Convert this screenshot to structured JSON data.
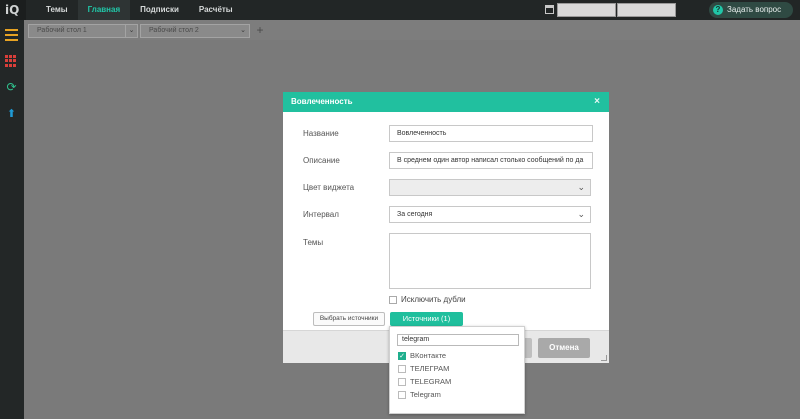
{
  "app": {
    "logo": "iQ"
  },
  "nav": {
    "tabs": [
      {
        "label": "Темы"
      },
      {
        "label": "Главная",
        "active": true
      },
      {
        "label": "Подписки"
      },
      {
        "label": "Расчёты"
      }
    ],
    "ask_button": "Задать вопрос",
    "date_from": "",
    "date_to": ""
  },
  "sidebar": {
    "icons": [
      "menu-icon",
      "grid-icon",
      "sync-icon",
      "upload-icon"
    ]
  },
  "desktops": {
    "items": [
      {
        "label": "Рабочий стол 1"
      },
      {
        "label": "Рабочий стол 2"
      }
    ],
    "add_label": "+"
  },
  "modal": {
    "title": "Вовлеченность",
    "close": "×",
    "fields": {
      "name": {
        "label": "Название",
        "value": "Вовлеченность"
      },
      "description": {
        "label": "Описание",
        "value": "В среднем один автор написал столько сообщений по да"
      },
      "color": {
        "label": "Цвет виджета",
        "value": ""
      },
      "interval": {
        "label": "Интервал",
        "value": "За сегодня"
      },
      "topics": {
        "label": "Темы",
        "value": ""
      }
    },
    "exclude_duplicates": {
      "label": "Исключить дубли",
      "checked": false
    },
    "pick_sources_button": "Выбрать источники",
    "sources_button": "Источники (1)",
    "cancel_button": "Отмена"
  },
  "sources_dropdown": {
    "search_value": "telegram",
    "options": [
      {
        "label": "ВКонтакте",
        "checked": true
      },
      {
        "label": "ТЕЛЕГРАМ",
        "checked": false
      },
      {
        "label": "TELEGRAM",
        "checked": false
      },
      {
        "label": "Telegram",
        "checked": false
      }
    ]
  },
  "colors": {
    "accent": "#21c09f",
    "topbar": "#222626",
    "overlay": "#7a7a7a"
  }
}
